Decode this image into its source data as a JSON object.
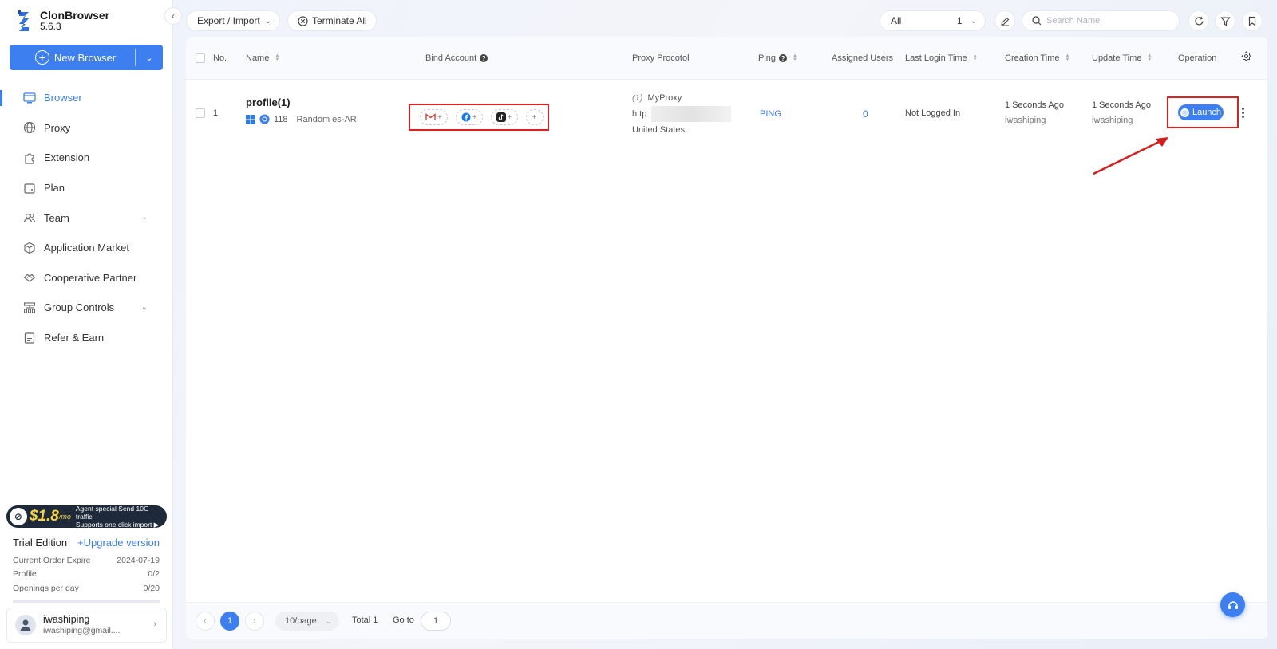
{
  "app": {
    "name": "ClonBrowser",
    "version": "5.6.3"
  },
  "sidebar": {
    "new_browser_label": "New Browser",
    "items": [
      {
        "label": "Browser",
        "icon": "browser-icon",
        "active": true
      },
      {
        "label": "Proxy",
        "icon": "globe-icon"
      },
      {
        "label": "Extension",
        "icon": "puzzle-icon"
      },
      {
        "label": "Plan",
        "icon": "wallet-icon"
      },
      {
        "label": "Team",
        "icon": "team-icon",
        "expandable": true
      },
      {
        "label": "Application Market",
        "icon": "cube-icon"
      },
      {
        "label": "Cooperative Partner",
        "icon": "handshake-icon"
      },
      {
        "label": "Group Controls",
        "icon": "hierarchy-icon",
        "expandable": true
      },
      {
        "label": "Refer & Earn",
        "icon": "gift-icon"
      }
    ],
    "promo": {
      "price": "$1.8",
      "unit": "/mo",
      "line1": "Agent special Send 10G traffic",
      "line2": "Supports one click import ▶"
    },
    "plan": {
      "title": "Trial Edition",
      "upgrade_label": "+Upgrade version",
      "rows": [
        {
          "label": "Current Order Expire",
          "value": "2024-07-19"
        },
        {
          "label": "Profile",
          "value": "0/2"
        },
        {
          "label": "Openings per day",
          "value": "0/20"
        }
      ]
    },
    "user": {
      "name": "iwashiping",
      "email": "iwashiping@gmail...."
    }
  },
  "toolbar": {
    "export_label": "Export / Import",
    "terminate_label": "Terminate All",
    "filter_value": "All",
    "filter_count": "1",
    "search_placeholder": "Search Name"
  },
  "table": {
    "headers": {
      "no": "No.",
      "name": "Name",
      "bind_account": "Bind Account",
      "proxy": "Proxy Procotol",
      "ping": "Ping",
      "assigned": "Assigned Users",
      "last_login": "Last Login Time",
      "creation": "Creation Time",
      "update": "Update Time",
      "operation": "Operation"
    },
    "rows": [
      {
        "no": "1",
        "name": "profile(1)",
        "browser_version": "118",
        "locale": "Random es-AR",
        "proxy_index": "(1)",
        "proxy_name": "MyProxy",
        "proxy_type": "http",
        "proxy_country": "United States",
        "ping": "PING",
        "assigned_users": "0",
        "last_login": "Not Logged In",
        "creation_time": "1 Seconds Ago",
        "creation_user": "iwashiping",
        "update_time": "1 Seconds Ago",
        "update_user": "iwashiping",
        "launch_label": "Launch"
      }
    ]
  },
  "pagination": {
    "current_page": "1",
    "page_size": "10/page",
    "total": "Total 1",
    "goto_label": "Go to",
    "goto_value": "1"
  },
  "colors": {
    "accent": "#3d7ef0",
    "highlight": "#e02020",
    "promo_bg": "#1e2a3a"
  }
}
